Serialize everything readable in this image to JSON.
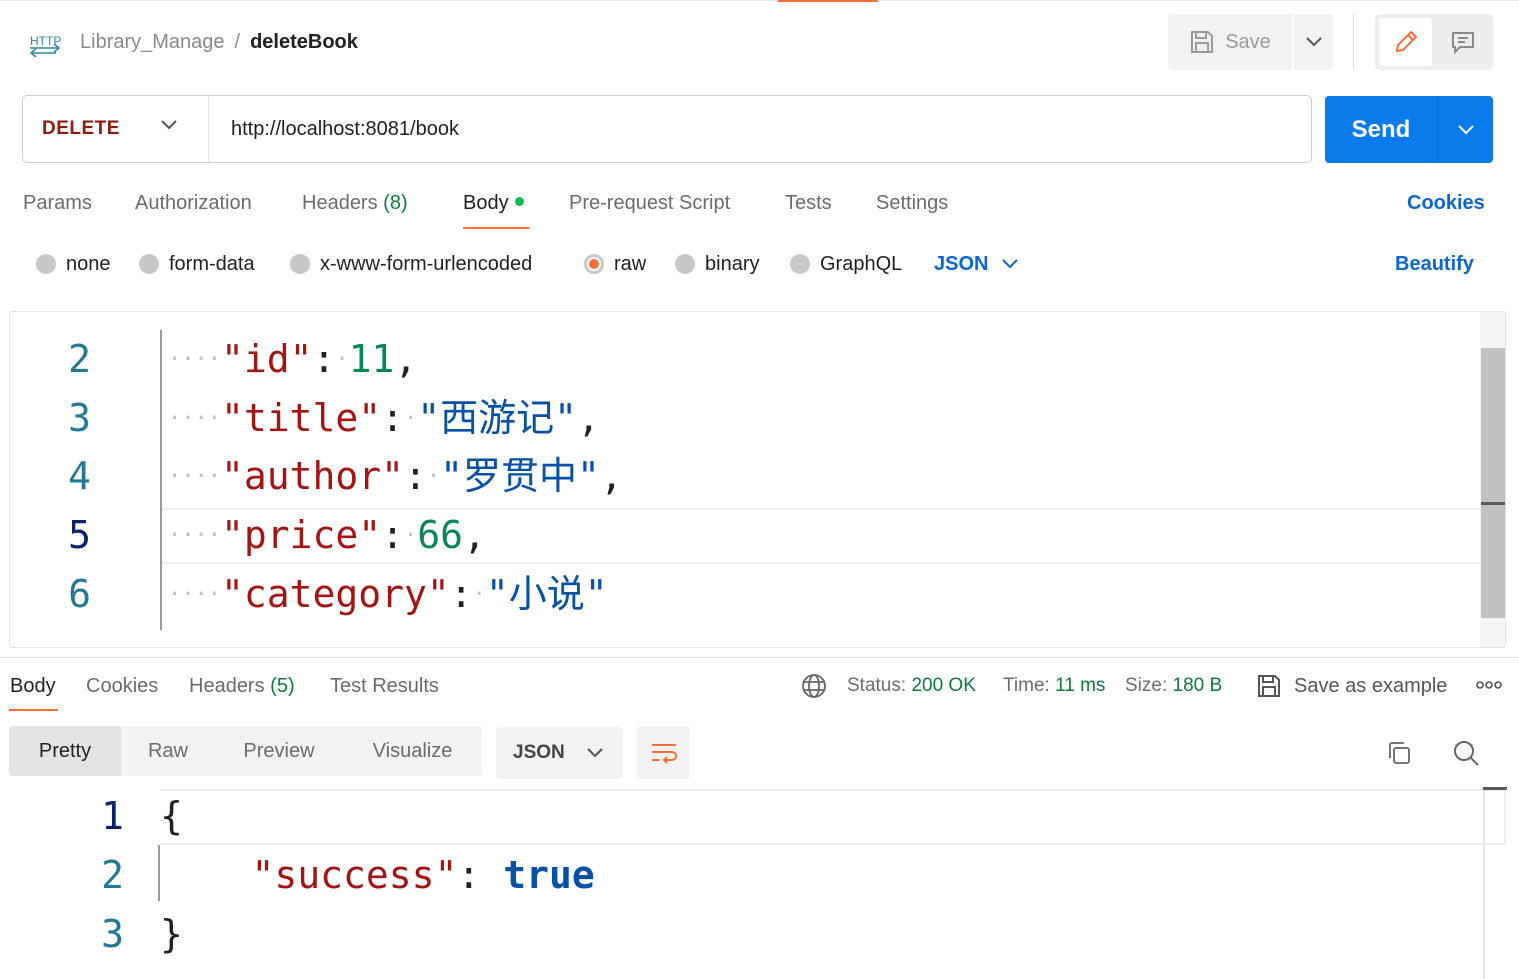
{
  "header": {
    "collection": "Library_Manage",
    "separator": "/",
    "request_name": "deleteBook",
    "save_label": "Save"
  },
  "request": {
    "method": "DELETE",
    "url": "http://localhost:8081/book",
    "send_label": "Send"
  },
  "request_tabs": {
    "params": "Params",
    "authorization": "Authorization",
    "headers_label": "Headers",
    "headers_count": "(8)",
    "body": "Body",
    "pre_request": "Pre-request Script",
    "tests": "Tests",
    "settings": "Settings",
    "cookies": "Cookies"
  },
  "body_types": {
    "none": "none",
    "form_data": "form-data",
    "urlencoded": "x-www-form-urlencoded",
    "raw": "raw",
    "binary": "binary",
    "graphql": "GraphQL",
    "language": "JSON",
    "beautify": "Beautify",
    "selected": "raw"
  },
  "request_body": {
    "lines": [
      {
        "n": "2",
        "key": "\"id\"",
        "value": "11",
        "value_type": "num",
        "trail": ","
      },
      {
        "n": "3",
        "key": "\"title\"",
        "value": "\"西游记\"",
        "value_type": "str",
        "trail": ","
      },
      {
        "n": "4",
        "key": "\"author\"",
        "value": "\"罗贯中\"",
        "value_type": "str",
        "trail": ","
      },
      {
        "n": "5",
        "key": "\"price\"",
        "value": "66",
        "value_type": "num",
        "trail": ","
      },
      {
        "n": "6",
        "key": "\"category\"",
        "value": "\"小说\"",
        "value_type": "str",
        "trail": ""
      }
    ]
  },
  "response_tabs": {
    "body": "Body",
    "cookies": "Cookies",
    "headers_label": "Headers",
    "headers_count": "(5)",
    "test_results": "Test Results"
  },
  "response_meta": {
    "status_label": "Status:",
    "status_value": "200 OK",
    "time_label": "Time:",
    "time_value": "11 ms",
    "size_label": "Size:",
    "size_value": "180 B",
    "save_example": "Save as example"
  },
  "response_format": {
    "pretty": "Pretty",
    "raw": "Raw",
    "preview": "Preview",
    "visualize": "Visualize",
    "language": "JSON"
  },
  "response_body": {
    "line1_n": "1",
    "line1": "{",
    "line2_n": "2",
    "line2_key": "\"success\"",
    "line2_colon": ":",
    "line2_value": "true",
    "line3_n": "3",
    "line3": "}"
  },
  "colors": {
    "accent": "#ff6c37",
    "send": "#097bed",
    "method_delete": "#8e1a10",
    "link": "#0a66d1",
    "success": "#0c7b3e"
  }
}
